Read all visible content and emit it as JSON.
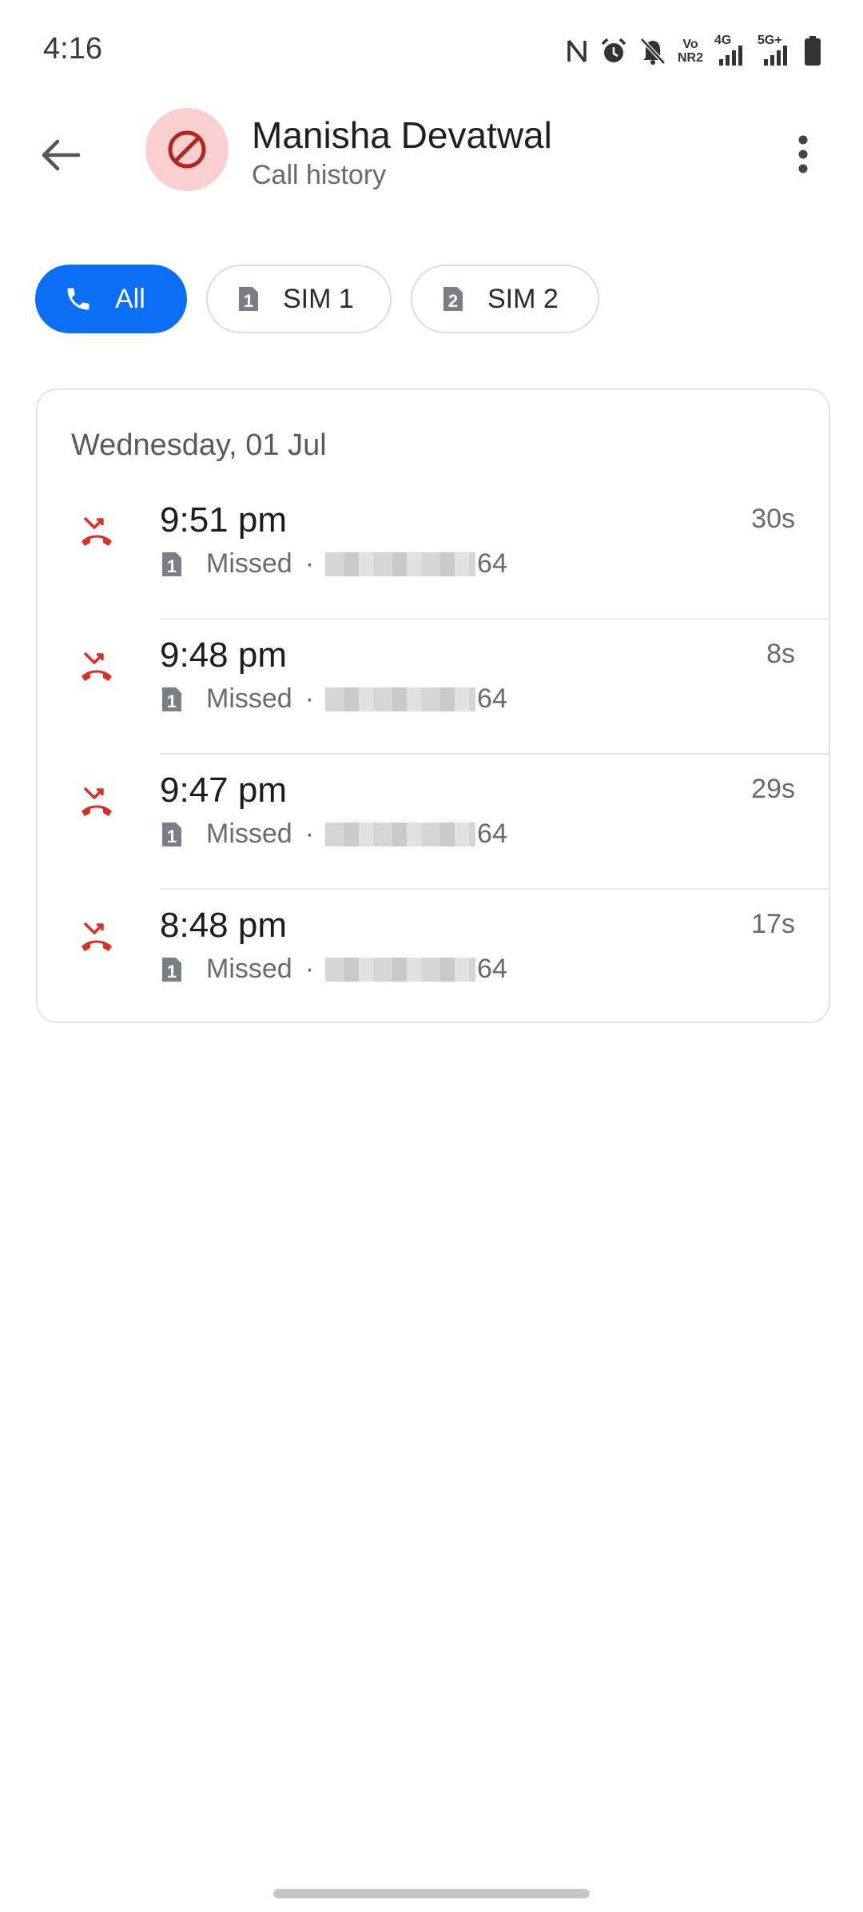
{
  "status_bar": {
    "time": "4:16",
    "icons": [
      "nfc-icon",
      "alarm-icon",
      "bell-off-icon",
      "volte-icon",
      "signal-4g-icon",
      "signal-5g-icon",
      "battery-icon"
    ],
    "volte_top": "Vo",
    "volte_bottom": "NR2",
    "net1": "4G",
    "net2": "5G+"
  },
  "header": {
    "name": "Manisha Devatwal",
    "subtitle": "Call history",
    "avatar_icon": "blocked-icon",
    "avatar_color": "#f9cfcf"
  },
  "filters": [
    {
      "label": "All",
      "icon": "phone-icon",
      "active": true
    },
    {
      "label": "SIM 1",
      "icon": "sim1-icon",
      "active": false
    },
    {
      "label": "SIM 2",
      "icon": "sim2-icon",
      "active": false
    }
  ],
  "accent_color": "#0b6ef5",
  "missed_color": "#d93025",
  "history": {
    "date": "Wednesday, 01 Jul",
    "calls": [
      {
        "time": "9:51 pm",
        "type": "Missed",
        "number_suffix": "64",
        "duration": "30s",
        "sim": "1"
      },
      {
        "time": "9:48 pm",
        "type": "Missed",
        "number_suffix": "64",
        "duration": "8s",
        "sim": "1"
      },
      {
        "time": "9:47 pm",
        "type": "Missed",
        "number_suffix": "64",
        "duration": "29s",
        "sim": "1"
      },
      {
        "time": "8:48 pm",
        "type": "Missed",
        "number_suffix": "64",
        "duration": "17s",
        "sim": "1"
      }
    ]
  }
}
